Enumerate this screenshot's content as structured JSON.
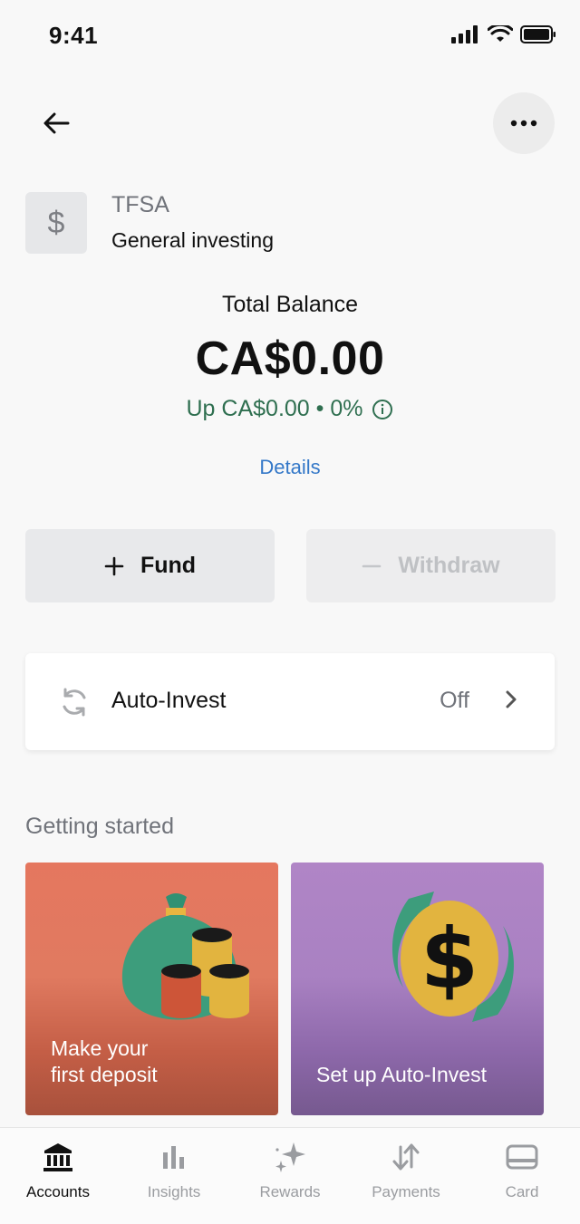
{
  "status_bar": {
    "time": "9:41"
  },
  "account": {
    "type": "TFSA",
    "name": "General investing",
    "icon_glyph": "$"
  },
  "balance": {
    "label": "Total Balance",
    "amount": "CA$0.00",
    "change": "Up CA$0.00 • 0%",
    "details_label": "Details"
  },
  "actions": {
    "fund_label": "Fund",
    "withdraw_label": "Withdraw"
  },
  "auto_invest": {
    "label": "Auto-Invest",
    "status": "Off"
  },
  "getting_started": {
    "title": "Getting started",
    "tiles": [
      {
        "label_line1": "Make your",
        "label_line2": "first deposit"
      },
      {
        "label": "Set up Auto-Invest"
      }
    ]
  },
  "tabs": [
    {
      "label": "Accounts",
      "icon": "bank-icon",
      "active": true
    },
    {
      "label": "Insights",
      "icon": "bar-chart-icon",
      "active": false
    },
    {
      "label": "Rewards",
      "icon": "sparkle-icon",
      "active": false
    },
    {
      "label": "Payments",
      "icon": "transfer-arrows-icon",
      "active": false
    },
    {
      "label": "Card",
      "icon": "card-icon",
      "active": false
    }
  ],
  "colors": {
    "positive": "#2f6f50",
    "link": "#3478c8",
    "deposit_tile": "#e5775f",
    "auto_invest_tile": "#b085c6"
  }
}
